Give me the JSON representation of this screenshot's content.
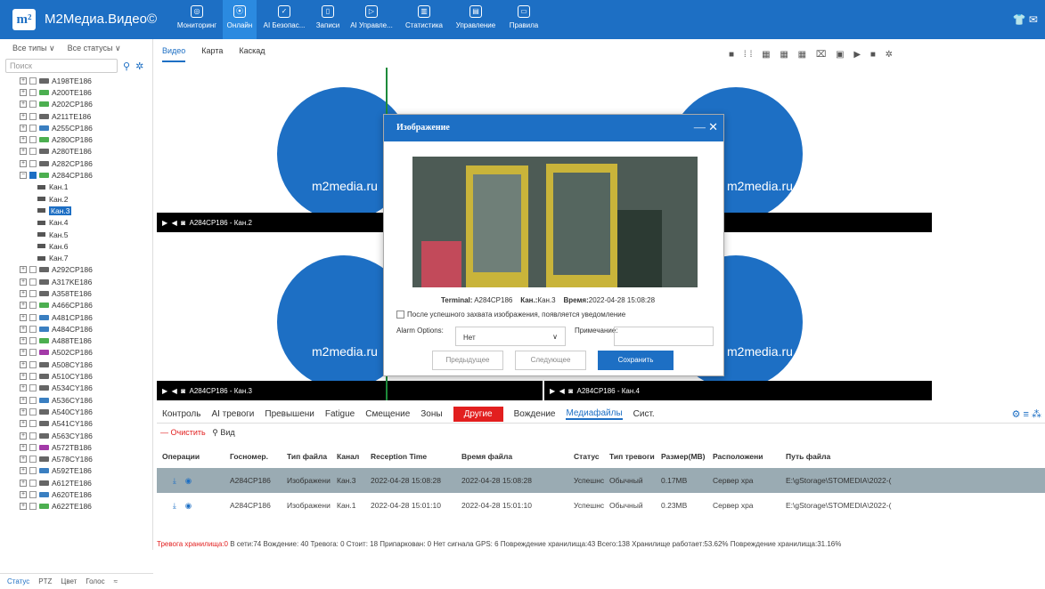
{
  "app": {
    "title": "M2Медиа.Видео©",
    "logo": "m²"
  },
  "nav": [
    {
      "label": "Мониторинг",
      "icon": "shield-icon",
      "glyph": "◎"
    },
    {
      "label": "Онлайн",
      "icon": "location-pin-icon",
      "glyph": "⦿"
    },
    {
      "label": "AI Безопас...",
      "icon": "shield-check-icon",
      "glyph": "✓"
    },
    {
      "label": "Записи",
      "icon": "recording-icon",
      "glyph": "▯"
    },
    {
      "label": "AI Управле...",
      "icon": "ai-manage-icon",
      "glyph": "▷"
    },
    {
      "label": "Статистика",
      "icon": "chart-icon",
      "glyph": "▥"
    },
    {
      "label": "Управление",
      "icon": "clipboard-icon",
      "glyph": "▤"
    },
    {
      "label": "Правила",
      "icon": "rules-icon",
      "glyph": "▭"
    }
  ],
  "topright": {
    "icons": [
      "shirt-icon",
      "mail-icon"
    ],
    "glyphs": "👕 ✉"
  },
  "sidebar": {
    "filter_types": "Все типы ∨",
    "filter_status": "Все статусы ∨",
    "search_placeholder": "Поиск",
    "vehicles_before": [
      {
        "name": "A198TE186",
        "color": "g"
      },
      {
        "name": "A200TE186",
        "color": "gr"
      },
      {
        "name": "A202CP186",
        "color": "gr"
      },
      {
        "name": "A211TE186",
        "color": "g"
      },
      {
        "name": "A255CP186",
        "color": "b"
      },
      {
        "name": "A280CP186",
        "color": "gr"
      },
      {
        "name": "A280TE186",
        "color": "g"
      },
      {
        "name": "A282CP186",
        "color": "g"
      }
    ],
    "expanded": {
      "name": "A284CP186",
      "color": "gr",
      "channels": [
        "Кан.1",
        "Кан.2",
        "Кан.3",
        "Кан.4",
        "Кан.5",
        "Кан.6",
        "Кан.7"
      ],
      "selected": "Кан.3"
    },
    "vehicles_after": [
      {
        "name": "A292CP186",
        "color": "g"
      },
      {
        "name": "A317KE186",
        "color": "g"
      },
      {
        "name": "A358TE186",
        "color": "g"
      },
      {
        "name": "A466CP186",
        "color": "gr"
      },
      {
        "name": "A481CP186",
        "color": "b"
      },
      {
        "name": "A484CP186",
        "color": "b"
      },
      {
        "name": "A488TE186",
        "color": "gr"
      },
      {
        "name": "A502CP186",
        "color": "p"
      },
      {
        "name": "A508CY186",
        "color": "g"
      },
      {
        "name": "A510CY186",
        "color": "g"
      },
      {
        "name": "A534CY186",
        "color": "g"
      },
      {
        "name": "A536CY186",
        "color": "b"
      },
      {
        "name": "A540CY186",
        "color": "g"
      },
      {
        "name": "A541CY186",
        "color": "g"
      },
      {
        "name": "A563CY186",
        "color": "g"
      },
      {
        "name": "A572TB186",
        "color": "p"
      },
      {
        "name": "A578CY186",
        "color": "g"
      },
      {
        "name": "A592TE186",
        "color": "b"
      },
      {
        "name": "A612TE186",
        "color": "g"
      },
      {
        "name": "A620TE186",
        "color": "b"
      },
      {
        "name": "A622TE186",
        "color": "gr"
      }
    ],
    "bottom_tabs": [
      "Статус",
      "PTZ",
      "Цвет",
      "Голос"
    ]
  },
  "subtabs": [
    "Видео",
    "Карта",
    "Каскад"
  ],
  "video": {
    "watermark": "m2media.ru",
    "cells": [
      {
        "label": "A284CP186 - Кан.2"
      },
      {
        "label": ""
      },
      {
        "label": "A284CP186 - Кан.3"
      },
      {
        "label": "A284CP186 - Кан.4"
      }
    ]
  },
  "dialog": {
    "title": "Изображение",
    "terminal_label": "Terminal:",
    "terminal": "A284CP186",
    "channel_label": "Кан.:",
    "channel": "Кан.3",
    "time_label": "Время:",
    "time": "2022-04-28 15:08:28",
    "checkbox": "После успешного захвата изображения, появляется уведомление",
    "alarm_label": "Alarm Options:",
    "alarm_value": "Нет",
    "note_label": "Примечание:",
    "prev": "Предыдущее",
    "next": "Следующее",
    "save": "Сохранить"
  },
  "bottom": {
    "tabs": [
      "Контроль",
      "AI тревоги",
      "Превышени",
      "Fatigue",
      "Смещение",
      "Зоны",
      "Другие",
      "Вождение",
      "Медиафайлы",
      "Сист."
    ],
    "clear": "Очистить",
    "view": "Вид",
    "columns": [
      "Операции",
      "Госномер.",
      "Тип файла",
      "Канал",
      "Reception Time",
      "Время файла",
      "Статус",
      "Тип тревоги",
      "Размер(MB)",
      "Расположени",
      "Путь файла"
    ],
    "rows": [
      [
        "A284CP186",
        "Изображени",
        "Кан.3",
        "2022-04-28 15:08:28",
        "2022-04-28 15:08:28",
        "Успешнс",
        "Обычный",
        "0.17MB",
        "Сервер хра",
        "E:\\gStorage\\STOMEDIA\\2022-("
      ],
      [
        "A284CP186",
        "Изображени",
        "Кан.1",
        "2022-04-28 15:01:10",
        "2022-04-28 15:01:10",
        "Успешнс",
        "Обычный",
        "0.23MB",
        "Сервер хра",
        "E:\\gStorage\\STOMEDIA\\2022-("
      ]
    ]
  },
  "status": {
    "storage_alarm": "Тревога хранилища:0",
    "rest": "В сети:74  Вождение: 40  Тревога: 0  Стоит: 18  Припаркован: 0  Нет сигнала GPS: 6  Повреждение хранилища:43  Всего:138  Хранилище работает:53.62%  Повреждение хранилища:31.16%"
  }
}
